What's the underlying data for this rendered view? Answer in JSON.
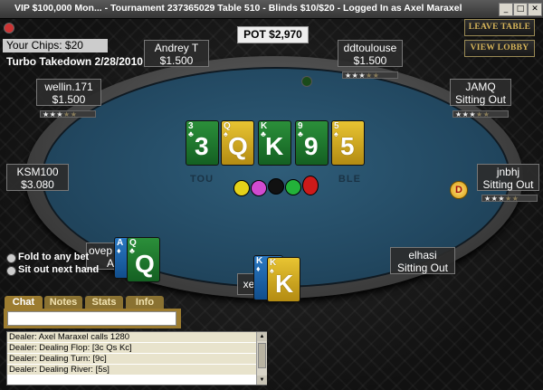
{
  "window": {
    "title": "VIP $100,000 Mon... - Tournament 237365029 Table 510 - Blinds $10/$20 - Logged In as Axel Maraxel"
  },
  "info": {
    "chips_label": "Your Chips: $20",
    "tournament_label": "Turbo Takedown 2/28/2010"
  },
  "pot": {
    "label": "POT $2,970"
  },
  "buttons": {
    "leave_table": "LEAVE TABLE",
    "view_lobby": "VIEW LOBBY"
  },
  "table": {
    "logo_text": "TOU                                  BLE"
  },
  "seats": [
    {
      "name": "Andrey T",
      "status": "$1.500"
    },
    {
      "name": "ddtoulouse",
      "status": "$1.500",
      "stars": 3
    },
    {
      "name": "wellin.171",
      "status": "$1.500",
      "stars": 3
    },
    {
      "name": "JAMQ",
      "status": "Sitting Out",
      "stars": 3
    },
    {
      "name": "KSM100",
      "status": "$3.080"
    },
    {
      "name": "jnbhj",
      "status": "Sitting Out",
      "stars": 3
    },
    {
      "name": "elhasi",
      "status": "Sitting Out"
    },
    {
      "name": "ovep",
      "status": "A"
    },
    {
      "name": "xe",
      "status": ""
    }
  ],
  "dealer_button": {
    "label": "D"
  },
  "board": [
    {
      "rank": "3",
      "suit": "♣",
      "color": "green"
    },
    {
      "rank": "Q",
      "suit": "♠",
      "color": "yellow"
    },
    {
      "rank": "K",
      "suit": "♣",
      "color": "green"
    },
    {
      "rank": "9",
      "suit": "♣",
      "color": "green"
    },
    {
      "rank": "5",
      "suit": "♠",
      "color": "yellow"
    }
  ],
  "hole_cards_left": [
    {
      "rank": "A",
      "suit": "♦",
      "color": "blue"
    },
    {
      "rank": "Q",
      "suit": "♣",
      "color": "green"
    }
  ],
  "hole_cards_bottom": [
    {
      "rank": "K",
      "suit": "♦",
      "color": "blue"
    },
    {
      "rank": "K",
      "suit": "♠",
      "color": "yellow"
    }
  ],
  "chips": [
    "#e5d21a",
    "#d04bd0",
    "#111111",
    "#23b23a",
    "#cc1a1a"
  ],
  "options": [
    {
      "label": "Fold to any bet"
    },
    {
      "label": "Sit out next hand"
    }
  ],
  "chat": {
    "tabs": [
      "Chat",
      "Notes",
      "Stats",
      "Info"
    ],
    "lines": [
      "Dealer: Axel Maraxel calls 1280",
      "Dealer: Dealing Flop: [3c Qs Kc]",
      "Dealer: Dealing Turn: [9c]",
      "Dealer: Dealing River: [5s]"
    ]
  },
  "colors": {
    "felt": "#224861",
    "button_text": "#d8b65a",
    "tab": "#8a7232"
  }
}
